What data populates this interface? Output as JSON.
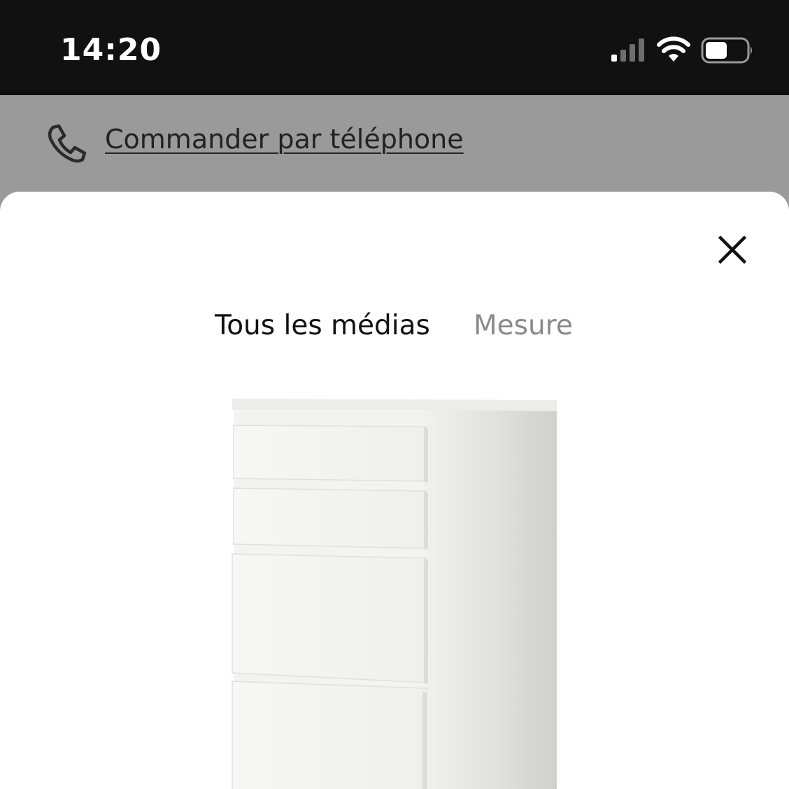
{
  "status_bar": {
    "time": "14:20",
    "icons": [
      "signal-icon",
      "wifi-icon",
      "battery-icon"
    ]
  },
  "phone_banner": {
    "icon": "phone-icon",
    "link_label": "Commander par téléphone"
  },
  "modal": {
    "close_icon": "close-icon",
    "tabs": [
      {
        "label": "Tous les médias",
        "active": true
      },
      {
        "label": "Mesure",
        "active": false
      }
    ]
  },
  "colors": {
    "status_bar_bg": "#111111",
    "overlay_bg": "#9a9a9a",
    "modal_bg": "#ffffff",
    "active_tab": "#111111",
    "inactive_tab": "#8a8a8a"
  }
}
